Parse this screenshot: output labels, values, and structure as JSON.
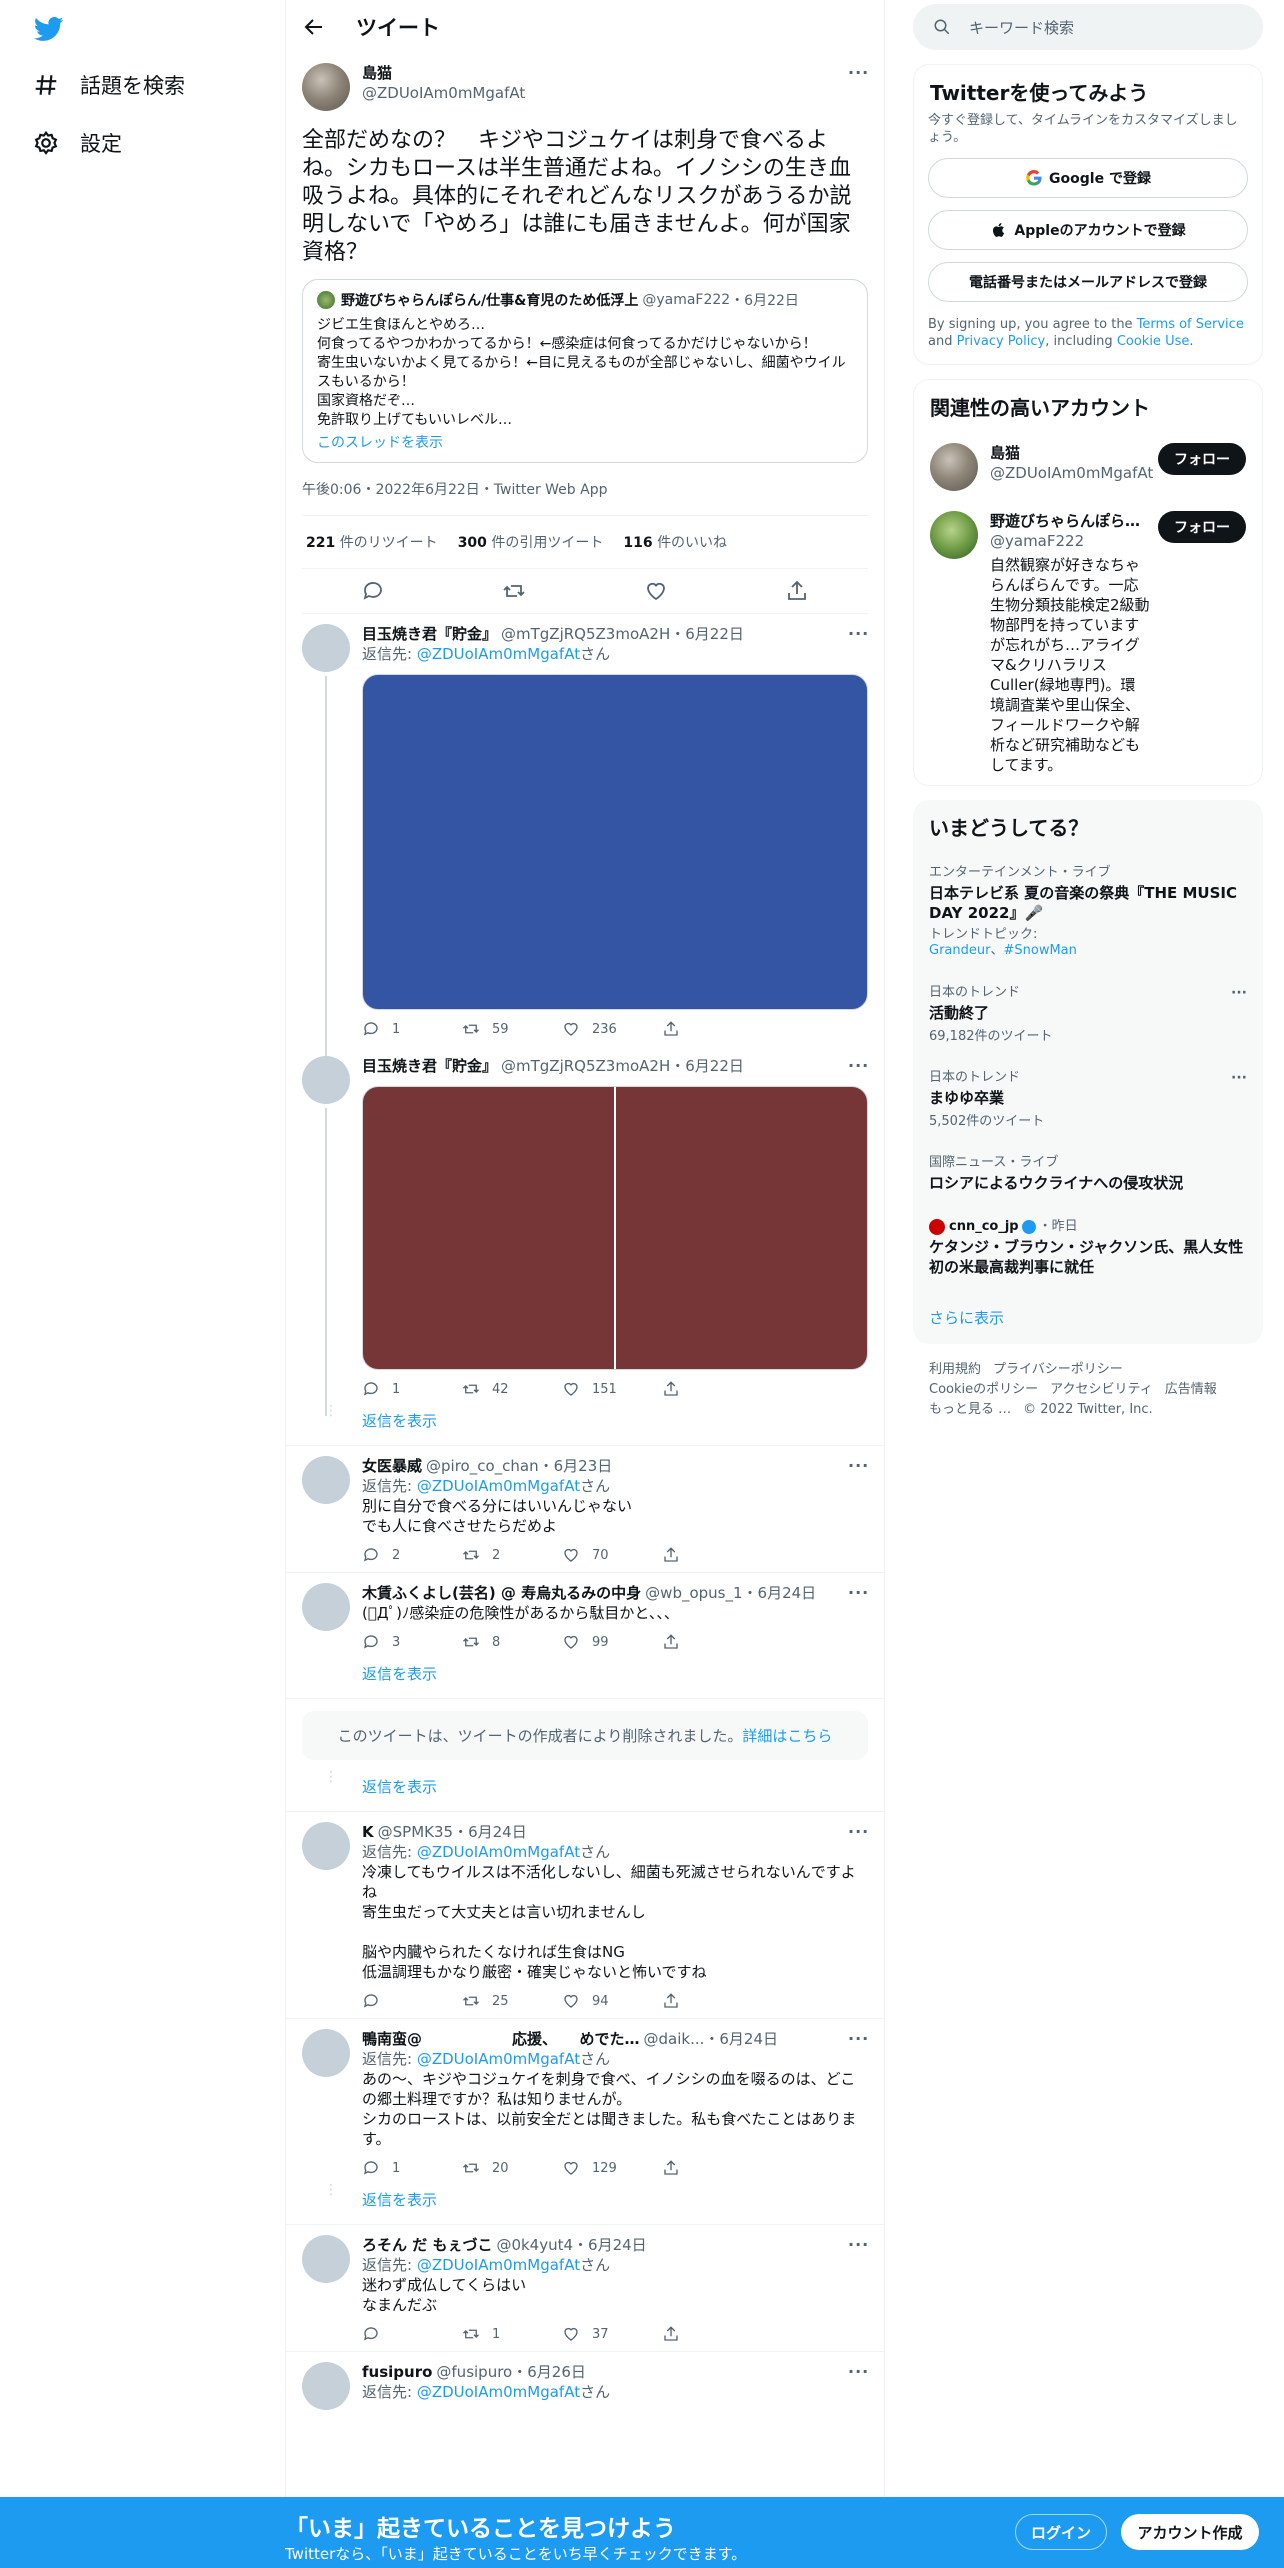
{
  "nav": {
    "items": [
      {
        "label": "話題を検索",
        "icon": "hashtag-icon"
      },
      {
        "label": "設定",
        "icon": "gear-icon"
      }
    ]
  },
  "header": {
    "title": "ツイート"
  },
  "focus": {
    "name": "島猫",
    "handle": "@ZDUoIAm0mMgafAt",
    "text": "全部だめなの？　キジやコジュケイは刺身で食べるよね。シカもロースは半生普通だよね。イノシシの生き血吸うよね。具体的にそれぞれどんなリスクがあうるか説明しないで「やめろ」は誰にも届きませんよ。何が国家資格？",
    "quote": {
      "name": "野遊びちゃらんぽらん/仕事&育児のため低浮上",
      "handle": "@yamaF222",
      "date": "・6月22日",
      "text": "ジビエ生食ほんとやめろ…\n何食ってるやつかわかってるから！←感染症は何食ってるかだけじゃないから！\n寄生虫いないかよく見てるから！←目に見えるものが全部じゃないし、細菌やウイルスもいるから！\n国家資格だぞ…\n免許取り上げてもいいレベル…",
      "link": "このスレッドを表示"
    },
    "meta": "午後0:06・2022年6月22日・Twitter Web App",
    "stats": {
      "rt_count": "221",
      "rt_label": "件のリツイート",
      "qt_count": "300",
      "qt_label": "件の引用ツイート",
      "like_count": "116",
      "like_label": "件のいいね"
    }
  },
  "replies": [
    {
      "name": "目玉焼き君『貯金』",
      "handle": "@mTgZjRQ5Z3moA2H",
      "date": "・6月22日",
      "reply_prefix": "返信先: ",
      "reply_to": "@ZDUoIAm0mMgafAt",
      "reply_suffix": "さん",
      "text": "",
      "replies": "1",
      "retweets": "59",
      "likes": "236",
      "media_color": "#3455a4"
    },
    {
      "name": "目玉焼き君『貯金』",
      "handle": "@mTgZjRQ5Z3moA2H",
      "date": "・6月22日",
      "text": "",
      "replies": "1",
      "retweets": "42",
      "likes": "151",
      "media_color": "#763638"
    },
    {
      "name": "女医暴威",
      "handle": "@piro_co_chan",
      "date": "・6月23日",
      "reply_prefix": "返信先: ",
      "reply_to": "@ZDUoIAm0mMgafAt",
      "reply_suffix": "さん",
      "text": "別に自分で食べる分にはいいんじゃない\nでも人に食べさせたらだめよ",
      "replies": "2",
      "retweets": "2",
      "likes": "70"
    },
    {
      "name": "木賃ふくよし(芸名) @ 寿烏丸るみの中身",
      "handle": "@wb_opus_1",
      "date": "・6月24日",
      "text": "(ﾟДﾟ)ﾉ感染症の危険性があるから駄目かと、、、",
      "replies": "3",
      "retweets": "8",
      "likes": "99"
    },
    {
      "name": "K",
      "handle": "@SPMK35",
      "date": "・6月24日",
      "reply_prefix": "返信先: ",
      "reply_to": "@ZDUoIAm0mMgafAt",
      "reply_suffix": "さん",
      "text": "冷凍してもウイルスは不活化しないし、細菌も死滅させられないんですよね\n寄生虫だって大丈夫とは言い切れませんし\n\n脳や内臓やられたくなければ生食はNG\n低温調理もかなり厳密・確実じゃないと怖いですね",
      "replies": "",
      "retweets": "25",
      "likes": "94"
    },
    {
      "name": "鴨南蛮@　　　　　　応援、　　めでた…",
      "handle": "@daik...",
      "date": "・6月24日",
      "reply_prefix": "返信先: ",
      "reply_to": "@ZDUoIAm0mMgafAt",
      "reply_suffix": "さん",
      "text": "あの〜、キジやコジュケイを刺身で食べ、イノシシの血を啜るのは、どこの郷土料理ですか？私は知りませんが。\nシカのローストは、以前安全だとは聞きました。私も食べたことはあります。",
      "replies": "1",
      "retweets": "20",
      "likes": "129"
    },
    {
      "name": "ろそん だ もぇづこ",
      "handle": "@0k4yut4",
      "date": "・6月24日",
      "reply_prefix": "返信先: ",
      "reply_to": "@ZDUoIAm0mMgafAt",
      "reply_suffix": "さん",
      "text": "迷わず成仏してくらはい\nなまんだぶ",
      "replies": "",
      "retweets": "1",
      "likes": "37"
    },
    {
      "name": "fusipuro",
      "handle": "@fusipuro",
      "date": "・6月26日",
      "reply_prefix": "返信先: ",
      "reply_to": "@ZDUoIAm0mMgafAt",
      "reply_suffix": "さん",
      "text": "",
      "replies": "",
      "retweets": "",
      "likes": ""
    }
  ],
  "show_replies": "返信を表示",
  "deleted": {
    "text": "このツイートは、ツイートの作成者により削除されました。",
    "link": "詳細はこちら"
  },
  "search": {
    "placeholder": "キーワード検索"
  },
  "signup": {
    "title": "Twitterを使ってみよう",
    "sub": "今すぐ登録して、タイムラインをカスタマイズしましょう。",
    "google": "Google で登録",
    "apple": "Appleのアカウントで登録",
    "phone": "電話番号またはメールアドレスで登録",
    "terms_1": "By signing up, you agree to the ",
    "terms_link1": "Terms of Service",
    "terms_2": " and ",
    "terms_link2": "Privacy Policy",
    "terms_3": ", including ",
    "terms_link3": "Cookie Use",
    "terms_4": "."
  },
  "related": {
    "title": "関連性の高いアカウント",
    "follow": "フォロー",
    "accounts": [
      {
        "name": "島猫",
        "handle": "@ZDUoIAm0mMgafAt",
        "bio": ""
      },
      {
        "name": "野遊びちゃらんぽら…",
        "handle": "@yamaF222",
        "bio": "自然観察が好きなちゃらんぽらんです。一応生物分類技能検定2級動物部門を持っていますが忘れがち…アライグマ&クリハラリスCuller(緑地専門)。環境調査業や里山保全、フィールドワークや解析など研究補助などもしてます。"
      }
    ]
  },
  "trends": {
    "title": "いまどうしてる？",
    "items": [
      {
        "cat": "エンターテインメント・ライブ",
        "name": "日本テレビ系 夏の音楽の祭典『THE MUSIC DAY 2022』🎤",
        "extra_label": "トレンドトピック: ",
        "extra_1": "Grandeur",
        "extra_sep": "、",
        "extra_2": "#SnowMan"
      },
      {
        "cat": "日本のトレンド",
        "name": "活動終了",
        "count": "69,182件のツイート"
      },
      {
        "cat": "日本のトレンド",
        "name": "まゆゆ卒業",
        "count": "5,502件のツイート"
      },
      {
        "cat": "国際ニュース・ライブ",
        "name": "ロシアによるウクライナへの侵攻状況"
      },
      {
        "source": "cnn_co_jp",
        "when": "・昨日",
        "name": "ケタンジ・ブラウン・ジャクソン氏、黒人女性初の米最高裁判事に就任"
      }
    ],
    "more": "さらに表示"
  },
  "footer": {
    "links": [
      "利用規約",
      "プライバシーポリシー",
      "Cookieのポリシー",
      "アクセシビリティ",
      "広告情報",
      "もっと見る …",
      "© 2022 Twitter, Inc."
    ]
  },
  "bottom": {
    "title": "「いま」起きていることを見つけよう",
    "sub": "Twitterなら、「いま」起きていることをいち早くチェックできます。",
    "login": "ログイン",
    "signup": "アカウント作成"
  },
  "colors": {
    "accent": "#1d9bf0",
    "text": "#0f1419",
    "muted": "#536471"
  }
}
